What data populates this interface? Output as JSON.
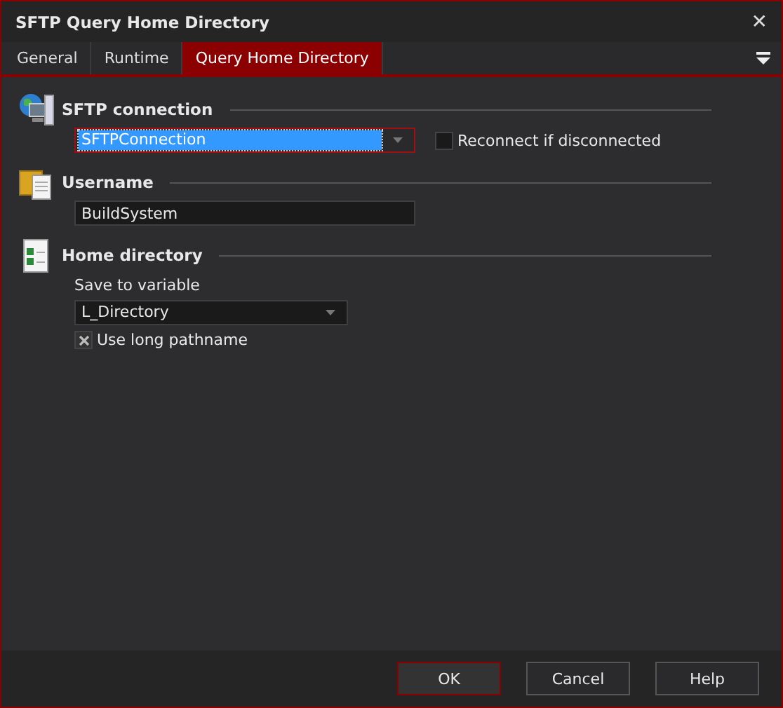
{
  "window": {
    "title": "SFTP Query Home Directory",
    "close": "✕"
  },
  "tabs": [
    {
      "label": "General",
      "selected": false
    },
    {
      "label": "Runtime",
      "selected": false
    },
    {
      "label": "Query Home Directory",
      "selected": true
    }
  ],
  "sections": [
    {
      "kind": "connection",
      "title": "SFTP connection",
      "combo": {
        "value": "SFTPConnection",
        "focused": true
      },
      "checkbox": {
        "label": "Reconnect if disconnected",
        "checked": false
      }
    },
    {
      "kind": "username",
      "title": "Username",
      "field": {
        "value": "BuildSystem"
      }
    },
    {
      "kind": "home",
      "title": "Home directory",
      "label": "Save to variable",
      "combo": {
        "value": "L_Directory",
        "focused": false
      },
      "checkbox": {
        "label": "Use long pathname",
        "checked": true
      }
    }
  ],
  "buttons": [
    {
      "label": "OK",
      "default": true
    },
    {
      "label": "Cancel",
      "default": false
    },
    {
      "label": "Help",
      "default": false
    }
  ]
}
